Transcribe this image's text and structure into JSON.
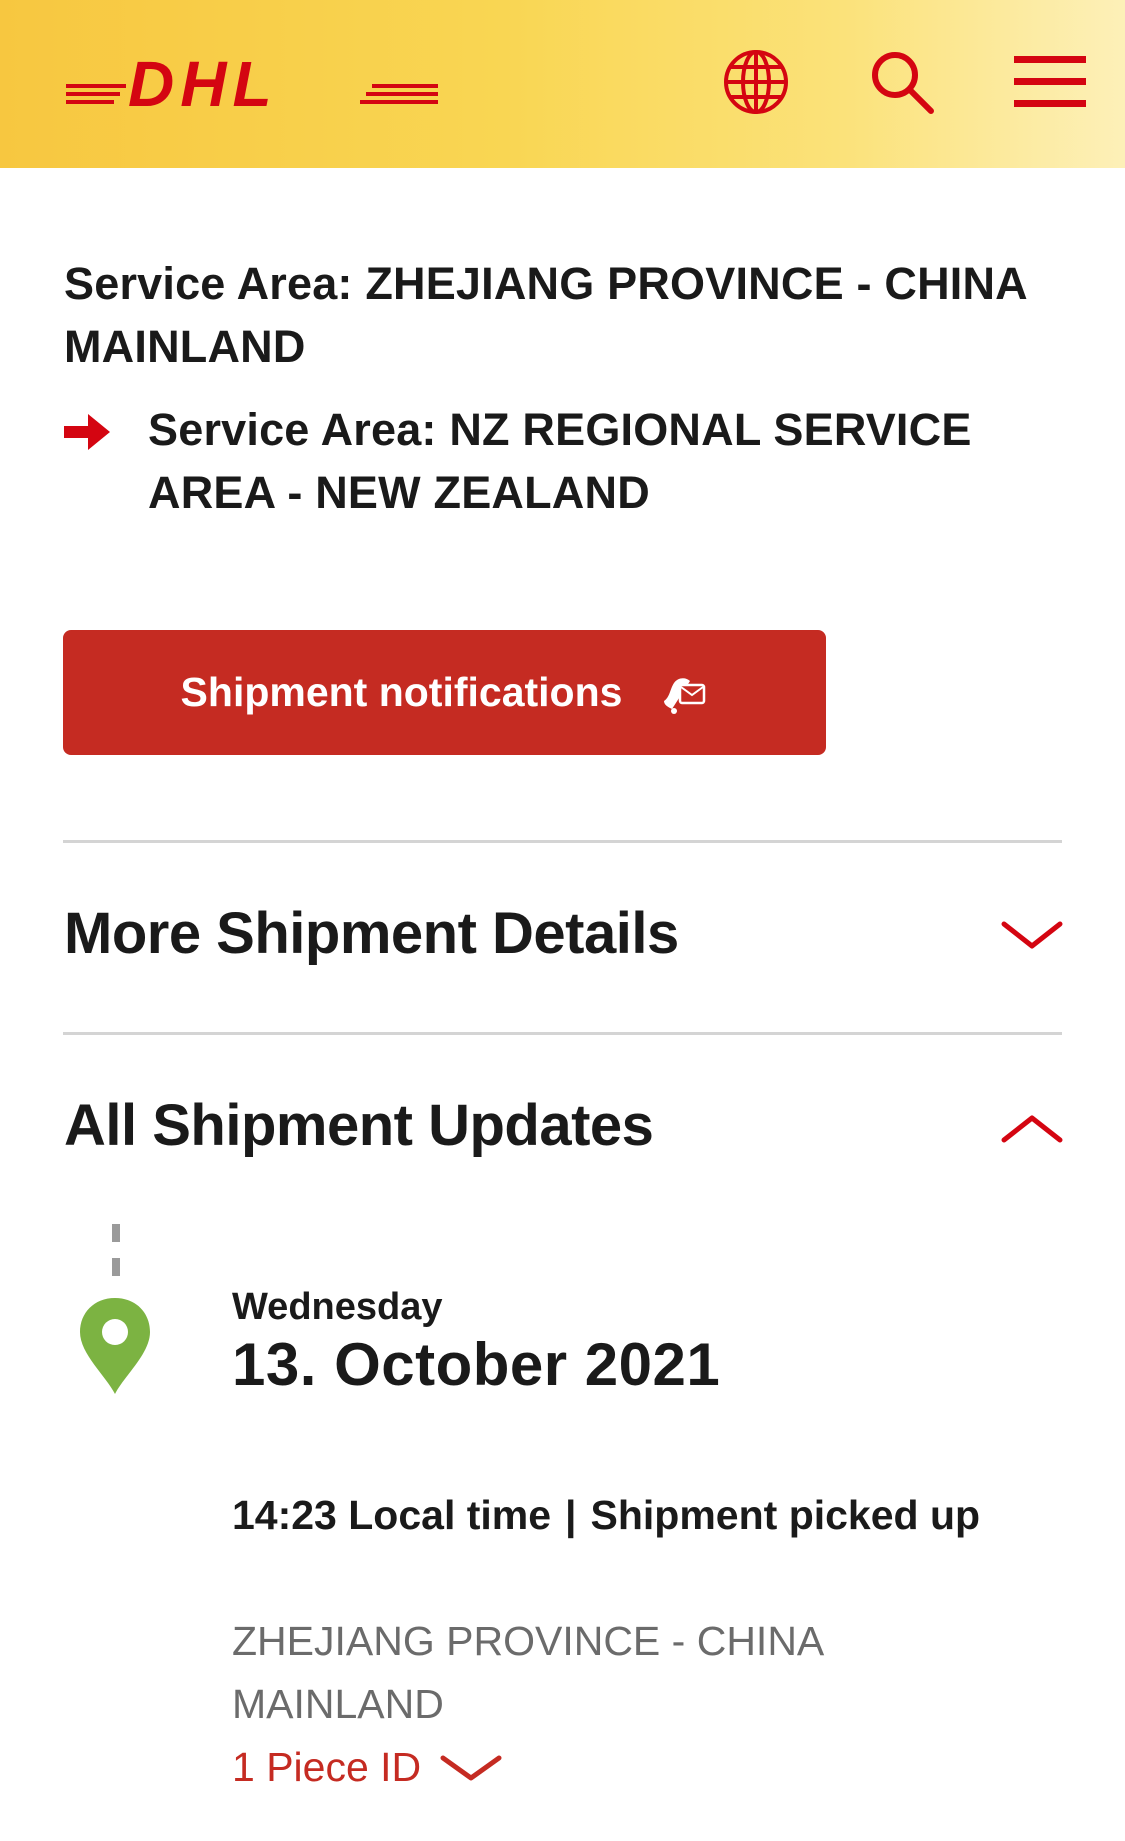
{
  "header": {
    "logo_text": "DHL",
    "icons": [
      "globe-icon",
      "search-icon",
      "menu-icon"
    ]
  },
  "service": {
    "from": "Service Area: ZHEJIANG PROVINCE - CHINA MAINLAND",
    "to": "Service Area: NZ REGIONAL SERVICE AREA - NEW ZEALAND"
  },
  "notifications_button": {
    "label": "Shipment notifications",
    "icon": "bell-mail-icon"
  },
  "sections": {
    "more_details": {
      "title": "More Shipment Details",
      "state": "collapsed"
    },
    "all_updates": {
      "title": "All Shipment Updates",
      "state": "expanded"
    }
  },
  "updates": {
    "day": {
      "weekday": "Wednesday",
      "date": "13. October 2021"
    },
    "event": {
      "time": "14:23 Local time",
      "separator": "|",
      "status": "Shipment picked up",
      "location": "ZHEJIANG PROVINCE - CHINA MAINLAND",
      "piece_link": "1 Piece ID"
    }
  },
  "colors": {
    "brand_red": "#c52b22",
    "brand_yellow": "#f9d653",
    "pin_green": "#7cb342",
    "muted_text": "#6b6b6b"
  }
}
